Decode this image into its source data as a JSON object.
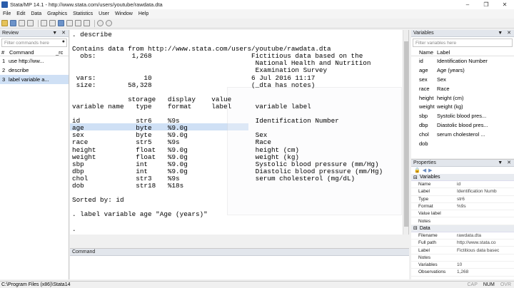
{
  "window": {
    "title": "Stata/MP 14.1 - http://www.stata.com/users/youtube/rawdata.dta",
    "controls": [
      "–",
      "❐",
      "✕"
    ]
  },
  "menu": [
    "File",
    "Edit",
    "Data",
    "Graphics",
    "Statistics",
    "User",
    "Window",
    "Help"
  ],
  "review": {
    "title": "Review",
    "filter_placeholder": "Filter commands here",
    "col_num": "#",
    "col_command": "Command",
    "col_rc": "_rc",
    "items": [
      {
        "num": "1",
        "command": "use http://ww..."
      },
      {
        "num": "2",
        "command": "describe"
      },
      {
        "num": "3",
        "command": "label variable a..."
      }
    ]
  },
  "results": {
    "text": ". describe\n\nContains data from http://www.stata.com/users/youtube/rawdata.dta\n  obs:         1,268                         Fictitious data based on the\n                                              National Health and Nutrition\n                                              Examination Survey\n vars:            10                         6 Jul 2016 11:17\n size:        58,328                         (_dta has notes)\n\n              storage   display    value\nvariable name   type    format     label      variable label\n\nid              str6    %9s                   Identification Number\nage             byte    %9.0g\nsex             byte    %9.0g                 Sex\nrace            str5    %9s                   Race\nheight          float   %9.0g                 height (cm)\nweight          float   %9.0g                 weight (kg)\nsbp             int     %9.0g                 Systolic blood pressure (mm/Hg)\ndbp             int     %9.0g                 Diastolic blood pressure (mm/Hg)\nchol            str3    %9s                   serum cholesterol (mg/dL)\ndob             str18   %18s\n\nSorted by: id\n\n. label variable age \"Age (years)\"\n\n."
  },
  "command": {
    "title": "Command"
  },
  "variables": {
    "title": "Variables",
    "filter_placeholder": "Filter variables here",
    "col_name": "Name",
    "col_label": "Label",
    "items": [
      {
        "name": "id",
        "label": "Identification Number"
      },
      {
        "name": "age",
        "label": "Age (years)"
      },
      {
        "name": "sex",
        "label": "Sex"
      },
      {
        "name": "race",
        "label": "Race"
      },
      {
        "name": "height",
        "label": "height (cm)"
      },
      {
        "name": "weight",
        "label": "weight (kg)"
      },
      {
        "name": "sbp",
        "label": "Systolic blood pres..."
      },
      {
        "name": "dbp",
        "label": "Diastolic blood pres..."
      },
      {
        "name": "chol",
        "label": "serum cholesterol ..."
      },
      {
        "name": "dob",
        "label": ""
      }
    ]
  },
  "properties": {
    "title": "Properties",
    "sections": [
      {
        "name": "Variables",
        "rows": [
          {
            "key": "Name",
            "value": "id"
          },
          {
            "key": "Label",
            "value": "Identification Numb"
          },
          {
            "key": "Type",
            "value": "str6"
          },
          {
            "key": "Format",
            "value": "%9s"
          },
          {
            "key": "Value label",
            "value": ""
          },
          {
            "key": "Notes",
            "value": ""
          }
        ]
      },
      {
        "name": "Data",
        "rows": [
          {
            "key": "Filename",
            "value": "rawdata.dta"
          },
          {
            "key": "Full path",
            "value": "http://www.stata.co"
          },
          {
            "key": "Label",
            "value": "Fictitious data basec"
          },
          {
            "key": "Notes",
            "value": ""
          },
          {
            "key": "Variables",
            "value": "10"
          },
          {
            "key": "Observations",
            "value": "1,268"
          }
        ]
      }
    ]
  },
  "status": {
    "path": "C:\\Program Files (x86)\\Stata14",
    "cap": "CAP",
    "num": "NUM",
    "ovr": "OVR"
  }
}
